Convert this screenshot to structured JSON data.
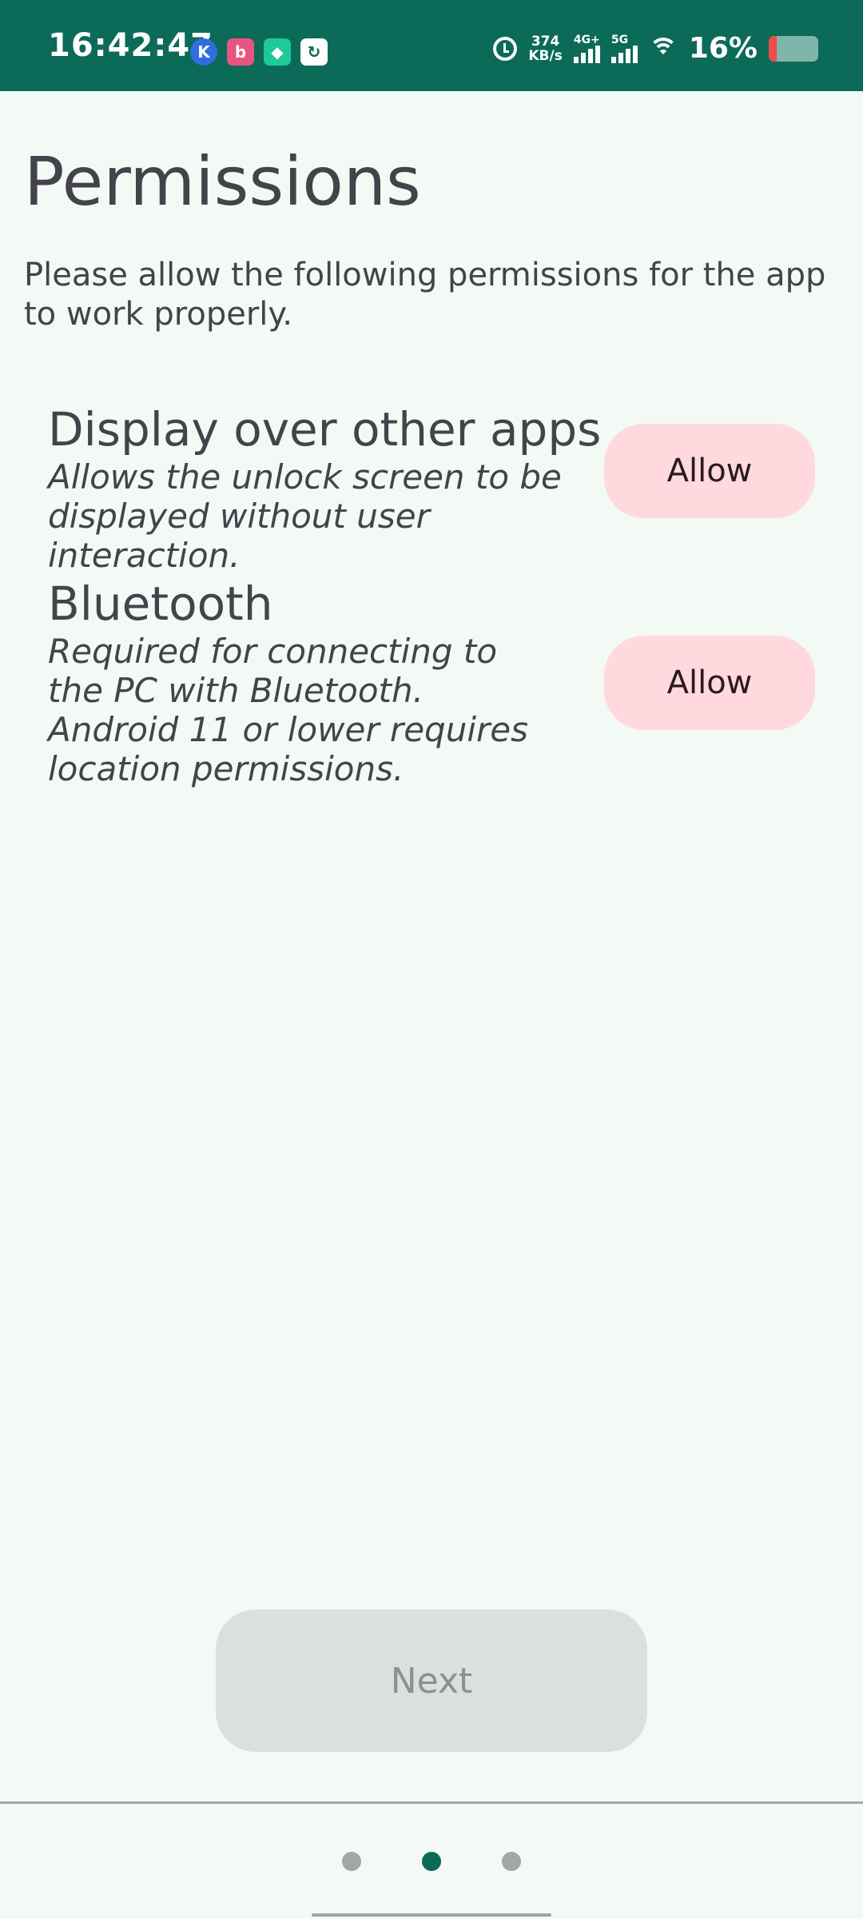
{
  "status_bar": {
    "time": "16:42:47",
    "notification_icons": [
      {
        "name": "kuwo-app-icon",
        "glyph": "K"
      },
      {
        "name": "bilibili-app-icon",
        "glyph": "b"
      },
      {
        "name": "security-shield-icon",
        "glyph": "◆"
      },
      {
        "name": "sync-app-icon",
        "glyph": "↻"
      }
    ],
    "net_speed_value": "374",
    "net_speed_unit": "KB/s",
    "signal1_label": "4G+",
    "signal2_label": "5G",
    "battery_percent": "16%",
    "battery_level": 0.16,
    "bar_color": "#0c6a58"
  },
  "page": {
    "title": "Permissions",
    "subtitle": "Please allow the following permissions for the app to work properly."
  },
  "permissions": [
    {
      "title": "Display over other apps",
      "description": "Allows the unlock screen to be displayed without user interaction.",
      "button_label": "Allow"
    },
    {
      "title": "Bluetooth",
      "description": "Required for connecting to the PC with Bluetooth. Android 11 or lower requires location permissions.",
      "button_label": "Allow"
    }
  ],
  "footer": {
    "next_label": "Next",
    "page_indicator": {
      "total": 3,
      "current": 2
    }
  },
  "colors": {
    "accent": "#0c6a58",
    "background": "#f3f9f5",
    "allow_button": "#ffd9de",
    "next_disabled": "#dbe0dc"
  }
}
